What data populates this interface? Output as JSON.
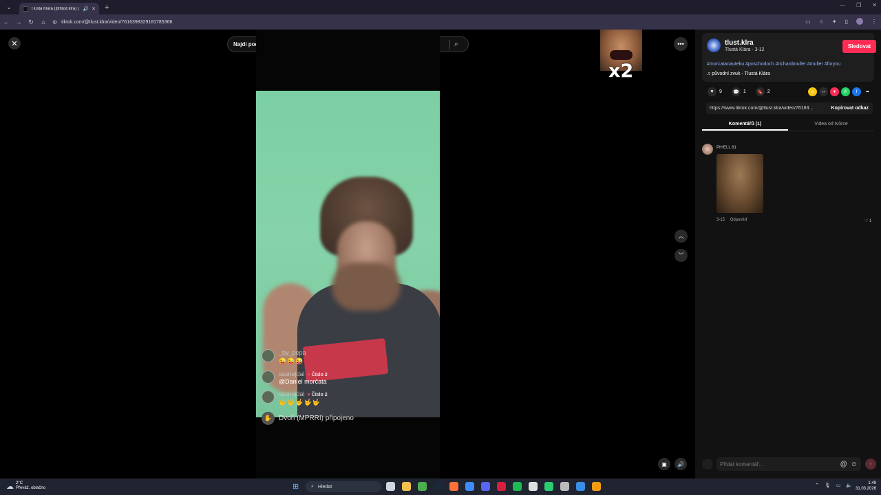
{
  "browser": {
    "tab_title": "Tlustá Klára (@tlust.klra) | T",
    "url": "tiktok.com/@tlust.klra/video/7616398329181785366"
  },
  "page": {
    "search_placeholder": "Najdi podobný obsah",
    "meme_text": "x2"
  },
  "live_comments": [
    {
      "name": "_by_pepa",
      "text": "😜😜😜",
      "badge": ""
    },
    {
      "name": "sssnejdal",
      "badge": "Číslo 2",
      "text": "@Daniel morčata"
    },
    {
      "name": "sssnejdal",
      "badge": "Číslo 2",
      "text": "🤟🤟🤟🤟🤟"
    }
  ],
  "joined": {
    "text": "Dvoři (MPRRI) připojeno"
  },
  "panel": {
    "username": "tlust.klra",
    "subtitle": "Tlustá Klára · 3-12",
    "follow_label": "Sledovat",
    "hashtags": "#morcatanauteku #poschodoch #richardmuller #muller #foryou",
    "sound": "původní zvuk - Tlustá Klára",
    "likes": "9",
    "comments": "1",
    "saves": "2",
    "link": "https://www.tiktok.com/@tlust.klra/video/76163...",
    "copy_label": "Kopírovat odkaz",
    "tab_comments": "Komentářů (1)",
    "tab_creator": "Videa od tvůrce",
    "comment": {
      "author": "PIHELL 81",
      "date": "3-15",
      "reply_label": "Odpověď",
      "likes": "1"
    },
    "compose_placeholder": "Přidat komentář..."
  },
  "taskbar": {
    "temp": "2°C",
    "weather": "Převáž. oblačno",
    "search": "Hledat",
    "time": "1:49",
    "date": "31.03.2026"
  },
  "colors": {
    "accent": "#fe2c55",
    "hashtag": "#8fb5ff",
    "panel_bg": "#121212",
    "video_bg": "#86d3a9"
  }
}
